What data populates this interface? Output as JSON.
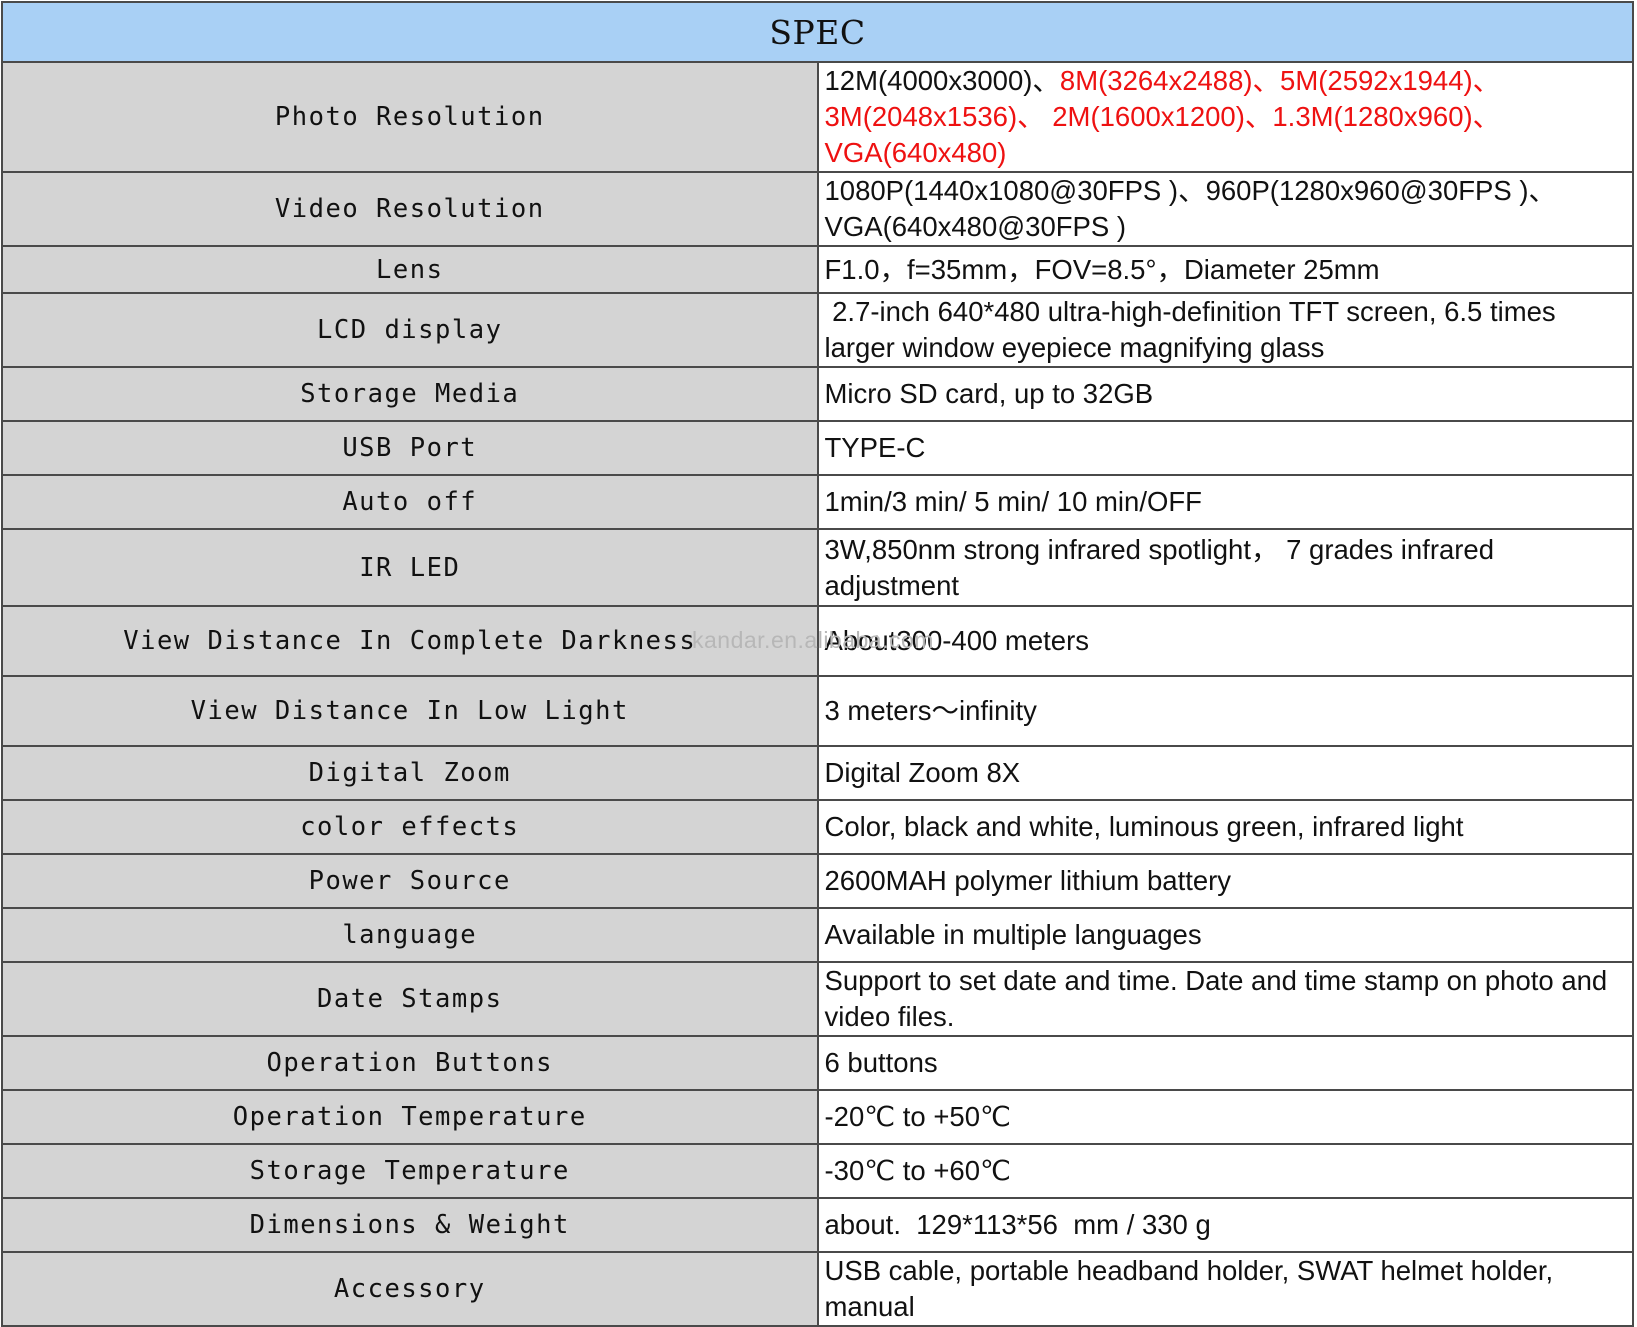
{
  "spec_table": {
    "title": "SPEC",
    "rows": [
      {
        "label": "Photo Resolution",
        "value_segments": [
          {
            "text": "12M(4000x3000)、",
            "color": "#111111"
          },
          {
            "text": "8M(3264x2488)、5M(2592x1944)、3M(2048x1536)、 2M(1600x1200)、1.3M(1280x960)、VGA(640x480)",
            "color": "#ee1111"
          }
        ]
      },
      {
        "label": "Video Resolution",
        "value": "1080P(1440x1080@30FPS )、960P(1280x960@30FPS )、VGA(640x480@30FPS )"
      },
      {
        "label": "Lens",
        "value": "F1.0，f=35mm，FOV=8.5°，Diameter 25mm"
      },
      {
        "label": "LCD display",
        "value": " 2.7-inch 640*480 ultra-high-definition TFT screen, 6.5 times larger window eyepiece magnifying glass"
      },
      {
        "label": "Storage Media",
        "value": "Micro SD card, up to 32GB"
      },
      {
        "label": "USB Port",
        "value": "TYPE-C"
      },
      {
        "label": "Auto off",
        "value": "1min/3 min/ 5 min/ 10 min/OFF"
      },
      {
        "label": "IR LED",
        "value": "3W,850nm strong infrared spotlight， 7 grades infrared adjustment"
      },
      {
        "label": "View Distance In Complete Darkness",
        "value": "About300-400 meters"
      },
      {
        "label": "View Distance In Low Light",
        "value": "3 meters～infinity"
      },
      {
        "label": "Digital Zoom",
        "value": "Digital Zoom 8X"
      },
      {
        "label": "color effects",
        "value": "Color, black and white, luminous green, infrared light"
      },
      {
        "label": "Power Source",
        "value": "2600MAH polymer lithium battery"
      },
      {
        "label": "language",
        "value": "Available in multiple languages"
      },
      {
        "label": "Date Stamps",
        "value": "Support to set date and time. Date and time stamp on photo and video files."
      },
      {
        "label": "Operation Buttons",
        "value": "6 buttons"
      },
      {
        "label": "Operation Temperature",
        "value": "-20℃ to +50℃"
      },
      {
        "label": "Storage Temperature",
        "value": "-30℃ to +60℃"
      },
      {
        "label": "Dimensions & Weight",
        "value": "about.  129*113*56  mm / 330 g"
      },
      {
        "label": "Accessory",
        "value": "USB cable, portable headband holder, SWAT helmet holder, manual"
      }
    ]
  },
  "watermark": "kandar.en.alibaba.com",
  "colors": {
    "header_bg": "#a9d0f5",
    "label_bg": "#d4d4d4",
    "highlight_text": "#ee1111"
  }
}
